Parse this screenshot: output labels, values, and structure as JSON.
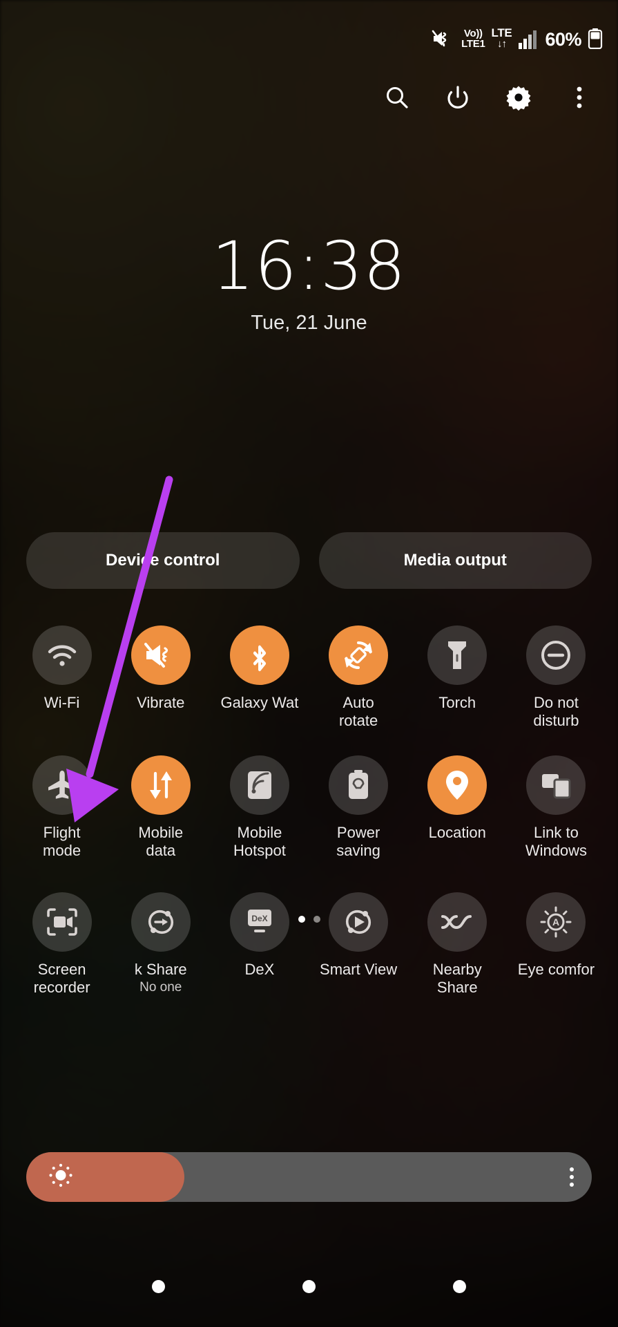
{
  "status_bar": {
    "icons": [
      "vibrate-icon",
      "volte-icon",
      "lte-data-icon",
      "signal-bars-icon"
    ],
    "volte_top": "Vo))",
    "volte_bottom": "LTE1",
    "lte_top": "LTE",
    "lte_arrows": "↓↑",
    "battery_percent": "60%"
  },
  "header": {
    "buttons": [
      {
        "name": "search-icon",
        "label": "Search"
      },
      {
        "name": "power-icon",
        "label": "Power off"
      },
      {
        "name": "gear-icon",
        "label": "Settings"
      },
      {
        "name": "more-options-icon",
        "label": "More options"
      }
    ]
  },
  "lockscreen": {
    "time": "16:38",
    "date": "Tue, 21 June"
  },
  "pills": [
    {
      "label": "Device control"
    },
    {
      "label": "Media output"
    }
  ],
  "quick_settings": {
    "rows": [
      [
        {
          "label": "Wi-Fi",
          "icon": "wifi-icon",
          "state": "off",
          "sub": ""
        },
        {
          "label": "Vibrate",
          "icon": "vibrate-icon",
          "state": "on",
          "sub": ""
        },
        {
          "label": "Galaxy Wat",
          "icon": "bluetooth-icon",
          "state": "on",
          "sub": "",
          "truncated": true
        },
        {
          "label": "Auto\nrotate",
          "icon": "auto-rotate-icon",
          "state": "on",
          "sub": ""
        },
        {
          "label": "Torch",
          "icon": "torch-icon",
          "state": "off",
          "sub": ""
        },
        {
          "label": "Do not\ndisturb",
          "icon": "do-not-disturb-icon",
          "state": "off",
          "sub": ""
        }
      ],
      [
        {
          "label": "Flight\nmode",
          "icon": "airplane-icon",
          "state": "off",
          "sub": ""
        },
        {
          "label": "Mobile\ndata",
          "icon": "mobile-data-icon",
          "state": "on",
          "sub": ""
        },
        {
          "label": "Mobile\nHotspot",
          "icon": "hotspot-icon",
          "state": "off",
          "sub": ""
        },
        {
          "label": "Power\nsaving",
          "icon": "power-saving-icon",
          "state": "off",
          "sub": ""
        },
        {
          "label": "Location",
          "icon": "location-pin-icon",
          "state": "on",
          "sub": ""
        },
        {
          "label": "Link to\nWindows",
          "icon": "link-to-windows-icon",
          "state": "off",
          "sub": ""
        }
      ],
      [
        {
          "label": "Screen\nrecorder",
          "icon": "screen-recorder-icon",
          "state": "off",
          "sub": ""
        },
        {
          "label": "k Share",
          "icon": "quick-share-icon",
          "state": "off",
          "sub": "No one",
          "truncated": true
        },
        {
          "label": "DeX",
          "icon": "dex-icon",
          "state": "off",
          "sub": ""
        },
        {
          "label": "Smart View",
          "icon": "smart-view-icon",
          "state": "off",
          "sub": ""
        },
        {
          "label": "Nearby\nShare",
          "icon": "nearby-share-icon",
          "state": "off",
          "sub": ""
        },
        {
          "label": "Eye comfor",
          "icon": "eye-comfort-icon",
          "state": "off",
          "sub": "",
          "truncated": true
        }
      ]
    ],
    "page_dots": {
      "count": 2,
      "active_index": 0
    }
  },
  "brightness": {
    "level_percent": 28,
    "icon": "brightness-sun-icon",
    "menu_icon": "more-options-icon"
  },
  "navigation_bar": {
    "buttons": [
      "recents-button",
      "home-button",
      "back-button"
    ]
  },
  "annotation": {
    "type": "arrow",
    "color": "#b93ff0",
    "points_to": "flight-mode-toggle"
  },
  "colors": {
    "toggle_on": "#ef9040",
    "toggle_off": "rgba(255,255,255,0.17)",
    "brightness_fill": "#c0674f",
    "brightness_track": "#5a5a5a",
    "annotation": "#b93ff0"
  }
}
